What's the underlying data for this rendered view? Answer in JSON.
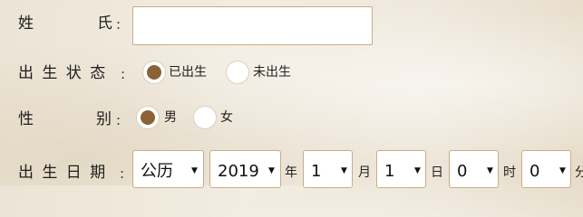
{
  "surname": {
    "label_first": "姓",
    "label_second": "氏",
    "colon": ":",
    "value": ""
  },
  "birth_status": {
    "label": "出 生 状 态",
    "colon": ":",
    "options": [
      {
        "label": "已出生",
        "checked": true
      },
      {
        "label": "未出生",
        "checked": false
      }
    ]
  },
  "gender": {
    "label_first": "性",
    "label_second": "别",
    "colon": ":",
    "options": [
      {
        "label": "男",
        "checked": true
      },
      {
        "label": "女",
        "checked": false
      }
    ]
  },
  "birth_date": {
    "label": "出 生 日 期",
    "colon": ":",
    "calendar": "公历",
    "year": "2019",
    "year_unit": "年",
    "month": "1",
    "month_unit": "月",
    "day": "1",
    "day_unit": "日",
    "hour": "0",
    "hour_unit": "时",
    "minute": "0",
    "minute_unit": "分",
    "caret": "▼"
  },
  "colors": {
    "accent": "#8b6236",
    "input_border": "#c9ad86"
  }
}
